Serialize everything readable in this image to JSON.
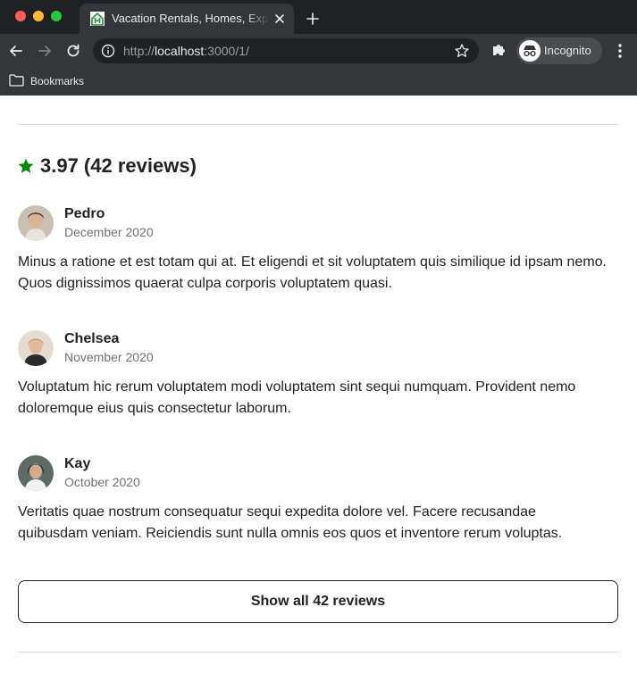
{
  "browser": {
    "tab_title": "Vacation Rentals, Homes, Experiences & Places - Airbnb",
    "url_scheme": "http://",
    "url_host": "localhost",
    "url_path": ":3000/1/",
    "profile_label": "Incognito",
    "bookmarks_label": "Bookmarks"
  },
  "reviews_section": {
    "rating_text": "3.97 (42 reviews)",
    "star_color": "#008a05",
    "reviews": [
      {
        "name": "Pedro",
        "date": "December 2020",
        "body": "Minus a ratione et est totam qui at. Et eligendi et sit voluptatem quis similique id ipsam nemo. Quos dignissimos quaerat culpa corporis voluptatem quasi."
      },
      {
        "name": "Chelsea",
        "date": "November 2020",
        "body": "Voluptatum hic rerum voluptatem modi voluptatem sint sequi numquam. Provident nemo doloremque eius quis consectetur laborum."
      },
      {
        "name": "Kay",
        "date": "October 2020",
        "body": "Veritatis quae nostrum consequatur sequi expedita dolore vel. Facere recusandae quibusdam veniam. Reiciendis sunt nulla omnis eos quos et inventore rerum voluptas."
      }
    ],
    "show_all_label": "Show all 42 reviews"
  }
}
